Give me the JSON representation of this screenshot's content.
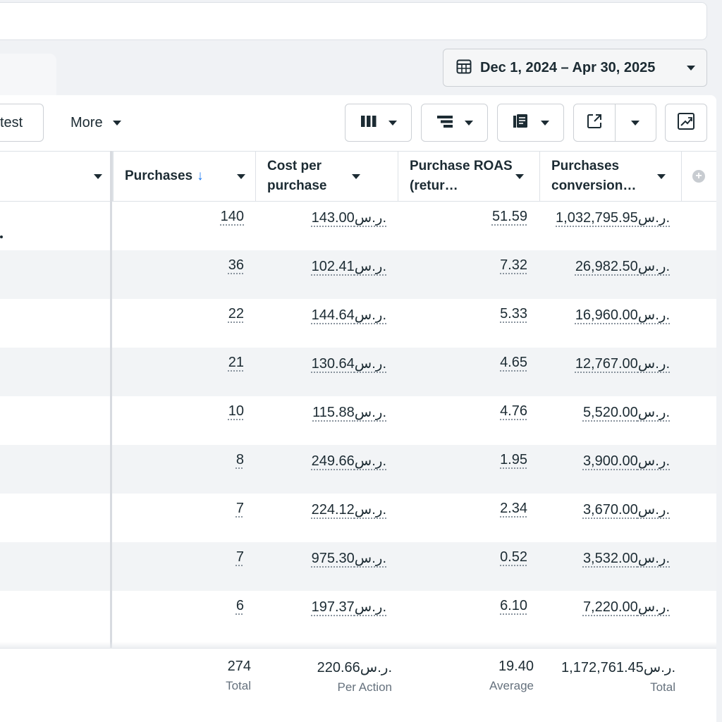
{
  "date_range": {
    "label": "Dec 1, 2024 – Apr 30, 2025"
  },
  "toolbar": {
    "test_label": "test",
    "more_label": "More"
  },
  "columns": [
    {
      "label": "Purchases",
      "sorted": "descending"
    },
    {
      "label": "Cost per purchase"
    },
    {
      "label": "Purchase ROAS (retur…"
    },
    {
      "label": "Purchases conversion…"
    }
  ],
  "rows": [
    {
      "purchases": "140",
      "cost_per_purchase": "143.00ر.س.",
      "roas": "51.59",
      "conversion_value": "1,032,795.95ر.س."
    },
    {
      "purchases": "36",
      "cost_per_purchase": "102.41ر.س.",
      "roas": "7.32",
      "conversion_value": "26,982.50ر.س."
    },
    {
      "purchases": "22",
      "cost_per_purchase": "144.64ر.س.",
      "roas": "5.33",
      "conversion_value": "16,960.00ر.س."
    },
    {
      "purchases": "21",
      "cost_per_purchase": "130.64ر.س.",
      "roas": "4.65",
      "conversion_value": "12,767.00ر.س."
    },
    {
      "purchases": "10",
      "cost_per_purchase": "115.88ر.س.",
      "roas": "4.76",
      "conversion_value": "5,520.00ر.س."
    },
    {
      "purchases": "8",
      "cost_per_purchase": "249.66ر.س.",
      "roas": "1.95",
      "conversion_value": "3,900.00ر.س."
    },
    {
      "purchases": "7",
      "cost_per_purchase": "224.12ر.س.",
      "roas": "2.34",
      "conversion_value": "3,670.00ر.س."
    },
    {
      "purchases": "7",
      "cost_per_purchase": "975.30ر.س.",
      "roas": "0.52",
      "conversion_value": "3,532.00ر.س."
    },
    {
      "purchases": "6",
      "cost_per_purchase": "197.37ر.س.",
      "roas": "6.10",
      "conversion_value": "7,220.00ر.س."
    }
  ],
  "totals": {
    "purchases": {
      "value": "274",
      "label": "Total"
    },
    "cost_per_purchase": {
      "value": "220.66ر.س.",
      "label": "Per Action"
    },
    "roas": {
      "value": "19.40",
      "label": "Average"
    },
    "conversion_value": {
      "value": "1,172,761.45ر.س.",
      "label": "Total"
    }
  },
  "colors": {
    "accent": "#1877f2",
    "row_alt": "#f2f4f6",
    "border": "#ccd0d5"
  },
  "icons": [
    "calendar-icon",
    "columns-icon",
    "breakdown-icon",
    "reports-icon",
    "export-icon",
    "chart-icon",
    "add-column-icon",
    "sort-down-icon"
  ]
}
